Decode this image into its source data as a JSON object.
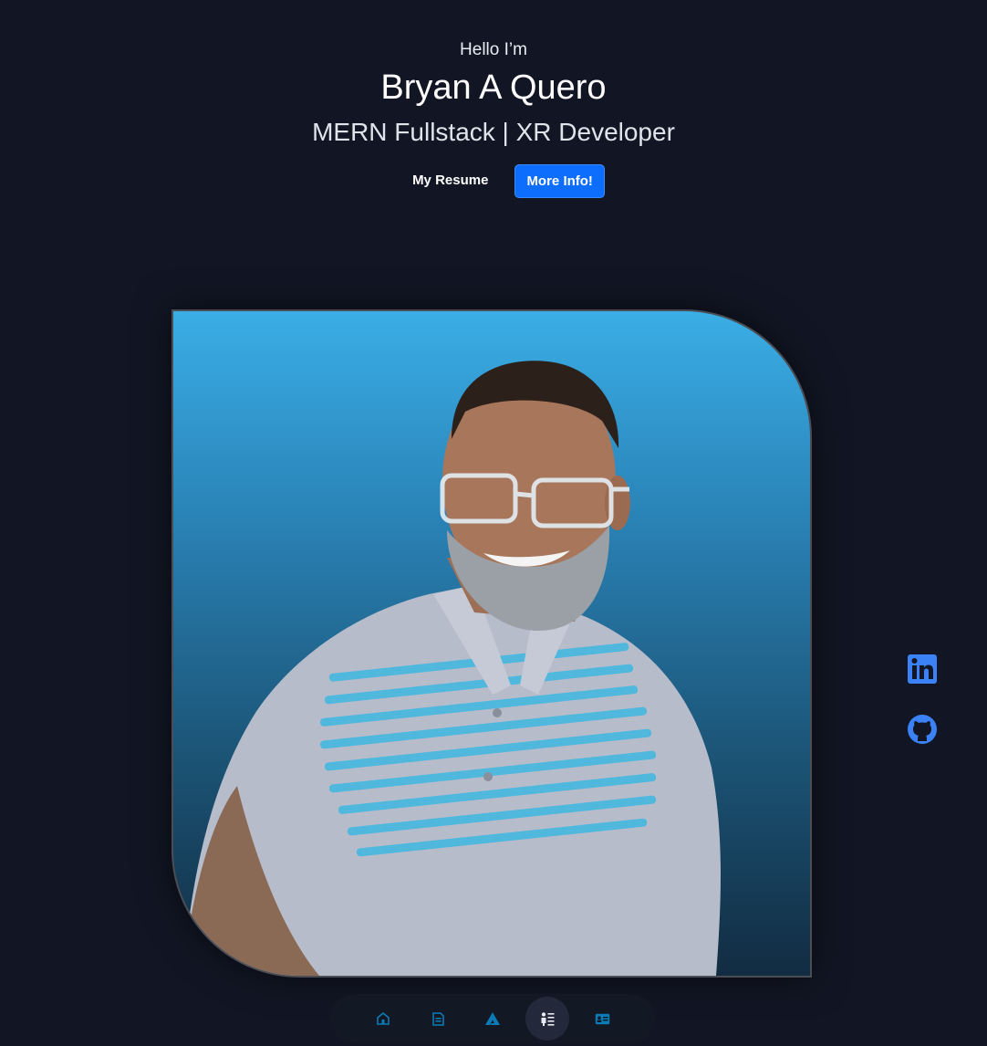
{
  "hero": {
    "greeting": "Hello I’m",
    "name": "Bryan A Quero",
    "role": "MERN Fullstack | XR Developer",
    "resume_label": "My Resume",
    "more_info_label": "More Info!"
  },
  "portrait": {
    "icon": "person-photo"
  },
  "socials": [
    {
      "name": "LinkedIn",
      "icon": "linkedin-icon"
    },
    {
      "name": "GitHub",
      "icon": "github-icon"
    }
  ],
  "nav": [
    {
      "name": "home",
      "icon": "home-icon",
      "active": false
    },
    {
      "name": "resume",
      "icon": "document-icon",
      "active": false
    },
    {
      "name": "skills",
      "icon": "triangle-logo-icon",
      "active": false
    },
    {
      "name": "about",
      "icon": "profile-list-icon",
      "active": true
    },
    {
      "name": "contact",
      "icon": "id-card-icon",
      "active": false
    }
  ],
  "colors": {
    "background": "#121624",
    "primary": "#0d6efd",
    "social": "#3b82f6",
    "nav_icon": "#0a7bb5"
  }
}
